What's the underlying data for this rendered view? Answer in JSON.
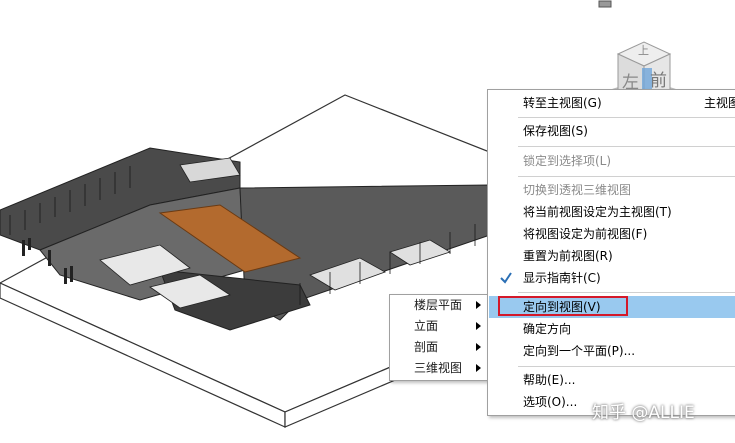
{
  "viewcube": {
    "top_label": "上",
    "front_label": "前",
    "left_label": "左"
  },
  "context_menu": {
    "items": [
      {
        "label": "转至主视图(G)",
        "shortcut": "主视图",
        "disabled": false
      },
      {
        "label": "保存视图(S)",
        "disabled": false
      },
      {
        "label": "锁定到选择项(L)",
        "disabled": true
      },
      {
        "label": "切换到透视三维视图",
        "disabled": true
      },
      {
        "label": "将当前视图设定为主视图(T)",
        "disabled": false
      },
      {
        "label": "将视图设定为前视图(F)",
        "disabled": false
      },
      {
        "label": "重置为前视图(R)",
        "disabled": false
      },
      {
        "label": "显示指南针(C)",
        "checked": true,
        "disabled": false
      },
      {
        "label": "定向到视图(V)",
        "highlighted": true,
        "disabled": false
      },
      {
        "label": "确定方向",
        "disabled": false
      },
      {
        "label": "定向到一个平面(P)...",
        "disabled": false
      },
      {
        "label": "帮助(E)...",
        "disabled": false
      },
      {
        "label": "选项(O)...",
        "disabled": false
      }
    ]
  },
  "submenu": {
    "items": [
      {
        "label": "楼层平面"
      },
      {
        "label": "立面"
      },
      {
        "label": "剖面"
      },
      {
        "label": "三维视图"
      }
    ]
  },
  "watermark": "知乎 @ALLIE",
  "colors": {
    "highlight": "#99c9ef",
    "annotation_box": "#d4192a"
  }
}
